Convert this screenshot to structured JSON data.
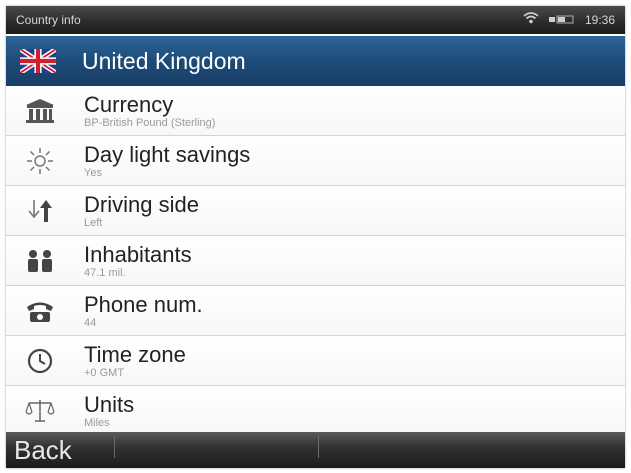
{
  "status_bar": {
    "title": "Country info",
    "time": "19:36",
    "icons": [
      "wifi-icon",
      "battery-icon"
    ]
  },
  "header": {
    "flag": "uk-flag-icon",
    "country": "United Kingdom"
  },
  "rows": [
    {
      "icon": "bank-icon",
      "label": "Currency",
      "value": "BP-British Pound (Sterling)"
    },
    {
      "icon": "sun-icon",
      "label": "Day light savings",
      "value": "Yes"
    },
    {
      "icon": "driving-side-icon",
      "label": "Driving side",
      "value": "Left"
    },
    {
      "icon": "people-icon",
      "label": "Inhabitants",
      "value": "47.1 mil."
    },
    {
      "icon": "phone-icon",
      "label": "Phone num.",
      "value": "44"
    },
    {
      "icon": "clock-icon",
      "label": "Time zone",
      "value": "+0 GMT"
    },
    {
      "icon": "scales-icon",
      "label": "Units",
      "value": "Miles"
    }
  ],
  "bottom_bar": {
    "back_label": "Back"
  },
  "colors": {
    "header_blue": "#1d4b78",
    "status_bar": "#2a2a2a",
    "label_text": "#222222",
    "value_text": "#9a9a9a"
  }
}
